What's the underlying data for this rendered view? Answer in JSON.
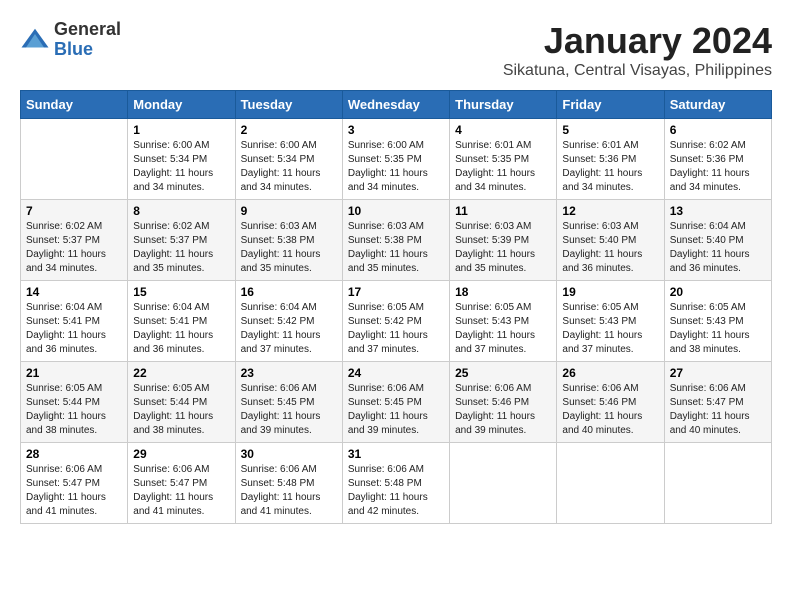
{
  "logo": {
    "general": "General",
    "blue": "Blue"
  },
  "title": "January 2024",
  "subtitle": "Sikatuna, Central Visayas, Philippines",
  "weekdays": [
    "Sunday",
    "Monday",
    "Tuesday",
    "Wednesday",
    "Thursday",
    "Friday",
    "Saturday"
  ],
  "weeks": [
    [
      {
        "day": "",
        "info": ""
      },
      {
        "day": "1",
        "info": "Sunrise: 6:00 AM\nSunset: 5:34 PM\nDaylight: 11 hours\nand 34 minutes."
      },
      {
        "day": "2",
        "info": "Sunrise: 6:00 AM\nSunset: 5:34 PM\nDaylight: 11 hours\nand 34 minutes."
      },
      {
        "day": "3",
        "info": "Sunrise: 6:00 AM\nSunset: 5:35 PM\nDaylight: 11 hours\nand 34 minutes."
      },
      {
        "day": "4",
        "info": "Sunrise: 6:01 AM\nSunset: 5:35 PM\nDaylight: 11 hours\nand 34 minutes."
      },
      {
        "day": "5",
        "info": "Sunrise: 6:01 AM\nSunset: 5:36 PM\nDaylight: 11 hours\nand 34 minutes."
      },
      {
        "day": "6",
        "info": "Sunrise: 6:02 AM\nSunset: 5:36 PM\nDaylight: 11 hours\nand 34 minutes."
      }
    ],
    [
      {
        "day": "7",
        "info": "Sunrise: 6:02 AM\nSunset: 5:37 PM\nDaylight: 11 hours\nand 34 minutes."
      },
      {
        "day": "8",
        "info": "Sunrise: 6:02 AM\nSunset: 5:37 PM\nDaylight: 11 hours\nand 35 minutes."
      },
      {
        "day": "9",
        "info": "Sunrise: 6:03 AM\nSunset: 5:38 PM\nDaylight: 11 hours\nand 35 minutes."
      },
      {
        "day": "10",
        "info": "Sunrise: 6:03 AM\nSunset: 5:38 PM\nDaylight: 11 hours\nand 35 minutes."
      },
      {
        "day": "11",
        "info": "Sunrise: 6:03 AM\nSunset: 5:39 PM\nDaylight: 11 hours\nand 35 minutes."
      },
      {
        "day": "12",
        "info": "Sunrise: 6:03 AM\nSunset: 5:40 PM\nDaylight: 11 hours\nand 36 minutes."
      },
      {
        "day": "13",
        "info": "Sunrise: 6:04 AM\nSunset: 5:40 PM\nDaylight: 11 hours\nand 36 minutes."
      }
    ],
    [
      {
        "day": "14",
        "info": "Sunrise: 6:04 AM\nSunset: 5:41 PM\nDaylight: 11 hours\nand 36 minutes."
      },
      {
        "day": "15",
        "info": "Sunrise: 6:04 AM\nSunset: 5:41 PM\nDaylight: 11 hours\nand 36 minutes."
      },
      {
        "day": "16",
        "info": "Sunrise: 6:04 AM\nSunset: 5:42 PM\nDaylight: 11 hours\nand 37 minutes."
      },
      {
        "day": "17",
        "info": "Sunrise: 6:05 AM\nSunset: 5:42 PM\nDaylight: 11 hours\nand 37 minutes."
      },
      {
        "day": "18",
        "info": "Sunrise: 6:05 AM\nSunset: 5:43 PM\nDaylight: 11 hours\nand 37 minutes."
      },
      {
        "day": "19",
        "info": "Sunrise: 6:05 AM\nSunset: 5:43 PM\nDaylight: 11 hours\nand 37 minutes."
      },
      {
        "day": "20",
        "info": "Sunrise: 6:05 AM\nSunset: 5:43 PM\nDaylight: 11 hours\nand 38 minutes."
      }
    ],
    [
      {
        "day": "21",
        "info": "Sunrise: 6:05 AM\nSunset: 5:44 PM\nDaylight: 11 hours\nand 38 minutes."
      },
      {
        "day": "22",
        "info": "Sunrise: 6:05 AM\nSunset: 5:44 PM\nDaylight: 11 hours\nand 38 minutes."
      },
      {
        "day": "23",
        "info": "Sunrise: 6:06 AM\nSunset: 5:45 PM\nDaylight: 11 hours\nand 39 minutes."
      },
      {
        "day": "24",
        "info": "Sunrise: 6:06 AM\nSunset: 5:45 PM\nDaylight: 11 hours\nand 39 minutes."
      },
      {
        "day": "25",
        "info": "Sunrise: 6:06 AM\nSunset: 5:46 PM\nDaylight: 11 hours\nand 39 minutes."
      },
      {
        "day": "26",
        "info": "Sunrise: 6:06 AM\nSunset: 5:46 PM\nDaylight: 11 hours\nand 40 minutes."
      },
      {
        "day": "27",
        "info": "Sunrise: 6:06 AM\nSunset: 5:47 PM\nDaylight: 11 hours\nand 40 minutes."
      }
    ],
    [
      {
        "day": "28",
        "info": "Sunrise: 6:06 AM\nSunset: 5:47 PM\nDaylight: 11 hours\nand 41 minutes."
      },
      {
        "day": "29",
        "info": "Sunrise: 6:06 AM\nSunset: 5:47 PM\nDaylight: 11 hours\nand 41 minutes."
      },
      {
        "day": "30",
        "info": "Sunrise: 6:06 AM\nSunset: 5:48 PM\nDaylight: 11 hours\nand 41 minutes."
      },
      {
        "day": "31",
        "info": "Sunrise: 6:06 AM\nSunset: 5:48 PM\nDaylight: 11 hours\nand 42 minutes."
      },
      {
        "day": "",
        "info": ""
      },
      {
        "day": "",
        "info": ""
      },
      {
        "day": "",
        "info": ""
      }
    ]
  ]
}
